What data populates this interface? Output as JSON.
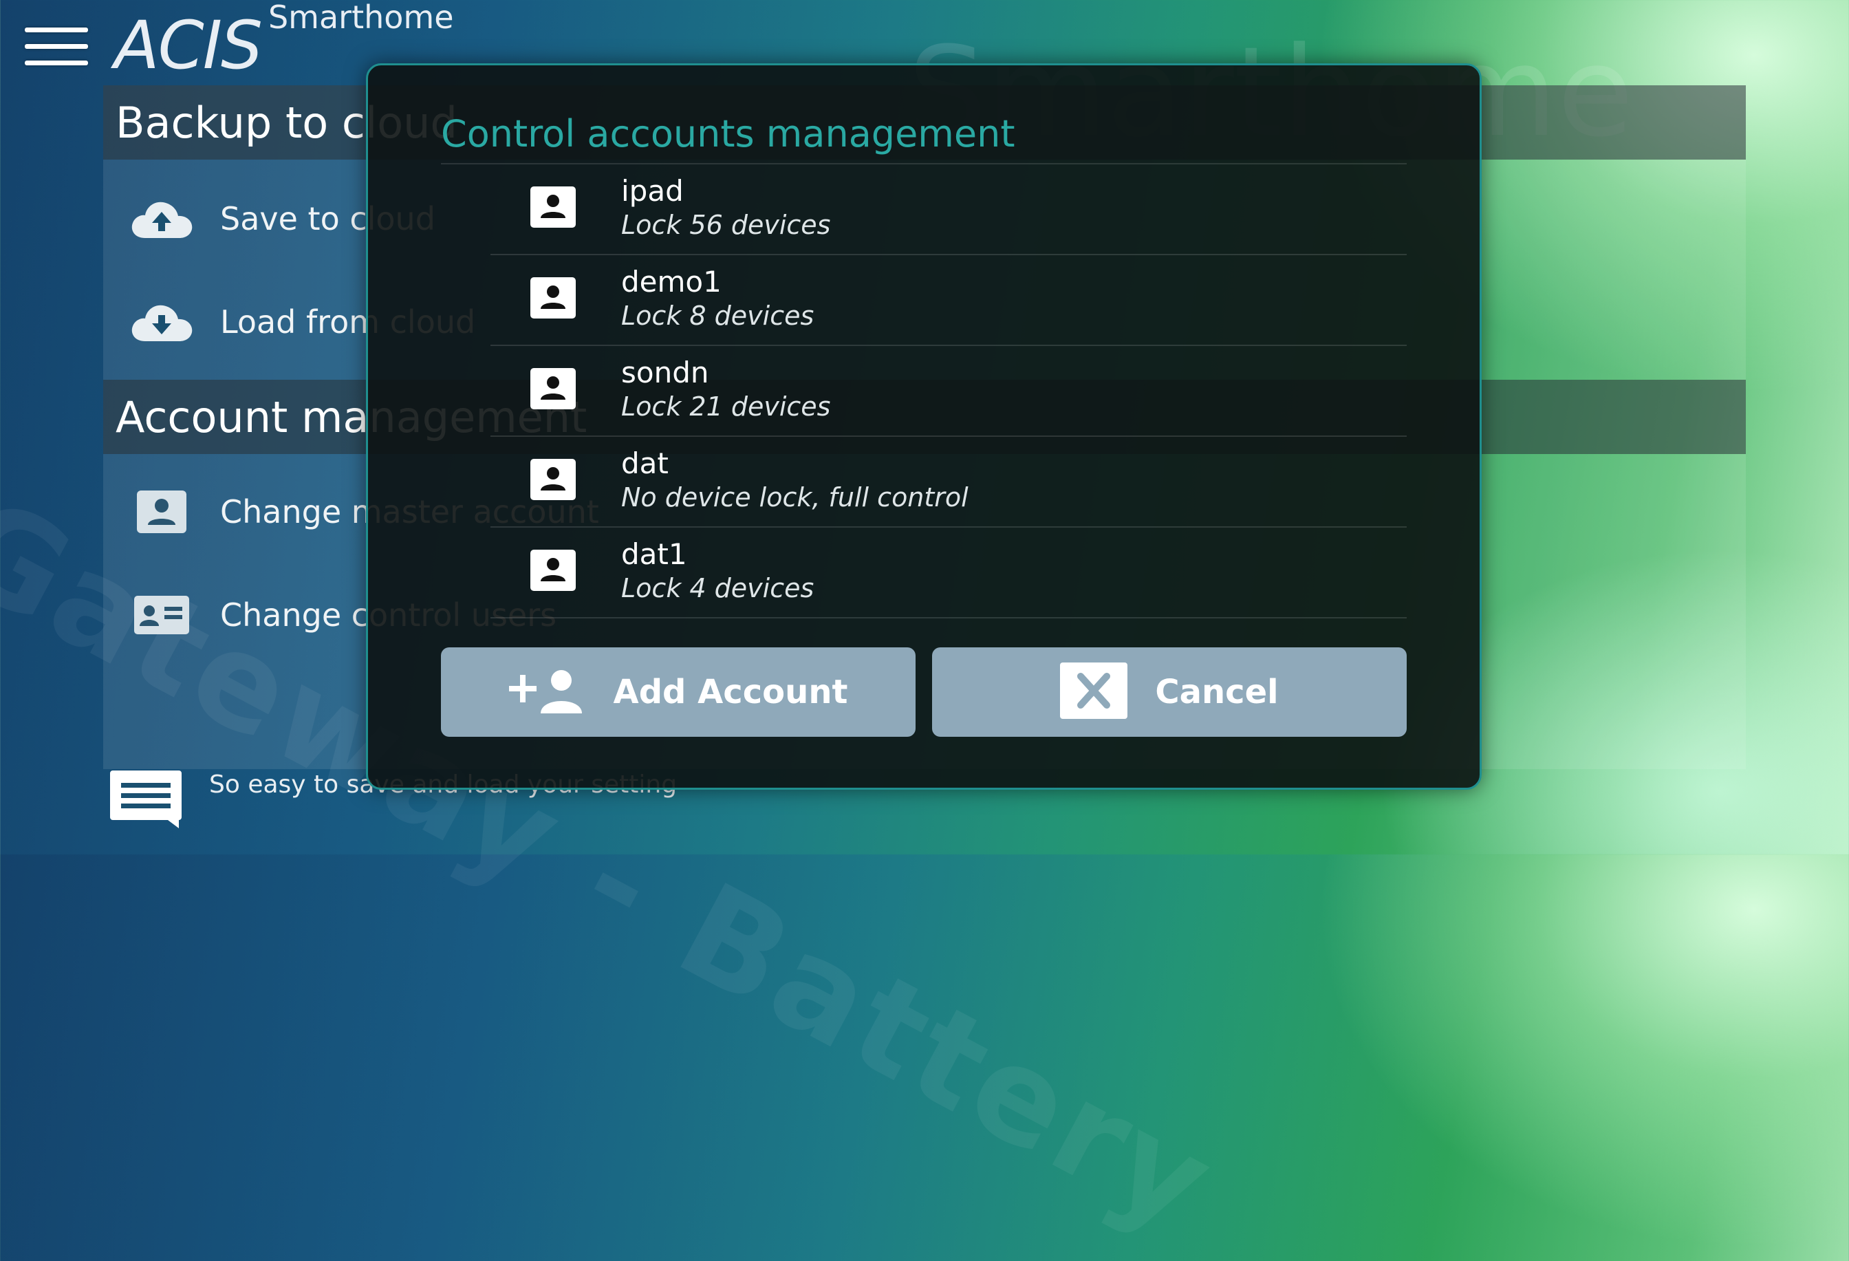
{
  "header": {
    "brand": "ACIS",
    "subtitle": "Smarthome",
    "menu_icon": "hamburger-menu-icon"
  },
  "background": {
    "big_title": "Smarthome",
    "watermark": "Gateway - Battery"
  },
  "settings": {
    "backup_section": {
      "title": "Backup to cloud",
      "items": [
        {
          "label": "Save to cloud",
          "icon": "cloud-upload-icon"
        },
        {
          "label": "Load from cloud",
          "icon": "cloud-download-icon"
        }
      ]
    },
    "account_section": {
      "title": "Account management",
      "items": [
        {
          "label": "Change master account",
          "icon": "account-box-icon"
        },
        {
          "label": "Change control users",
          "icon": "id-card-icon"
        }
      ]
    },
    "footer_note": "So easy to save and load your setting"
  },
  "dialog": {
    "title": "Control accounts management",
    "accounts": [
      {
        "name": "ipad",
        "description": "Lock 56 devices"
      },
      {
        "name": "demo1",
        "description": "Lock 8 devices"
      },
      {
        "name": "sondn",
        "description": "Lock 21 devices"
      },
      {
        "name": "dat",
        "description": "No device lock, full control"
      },
      {
        "name": "dat1",
        "description": "Lock 4 devices"
      }
    ],
    "add_button": "Add Account",
    "cancel_button": "Cancel"
  },
  "colors": {
    "dialog_title": "#2aa9a3",
    "dialog_border": "#1f8f8f",
    "button_bg": "#8fa9ba"
  }
}
